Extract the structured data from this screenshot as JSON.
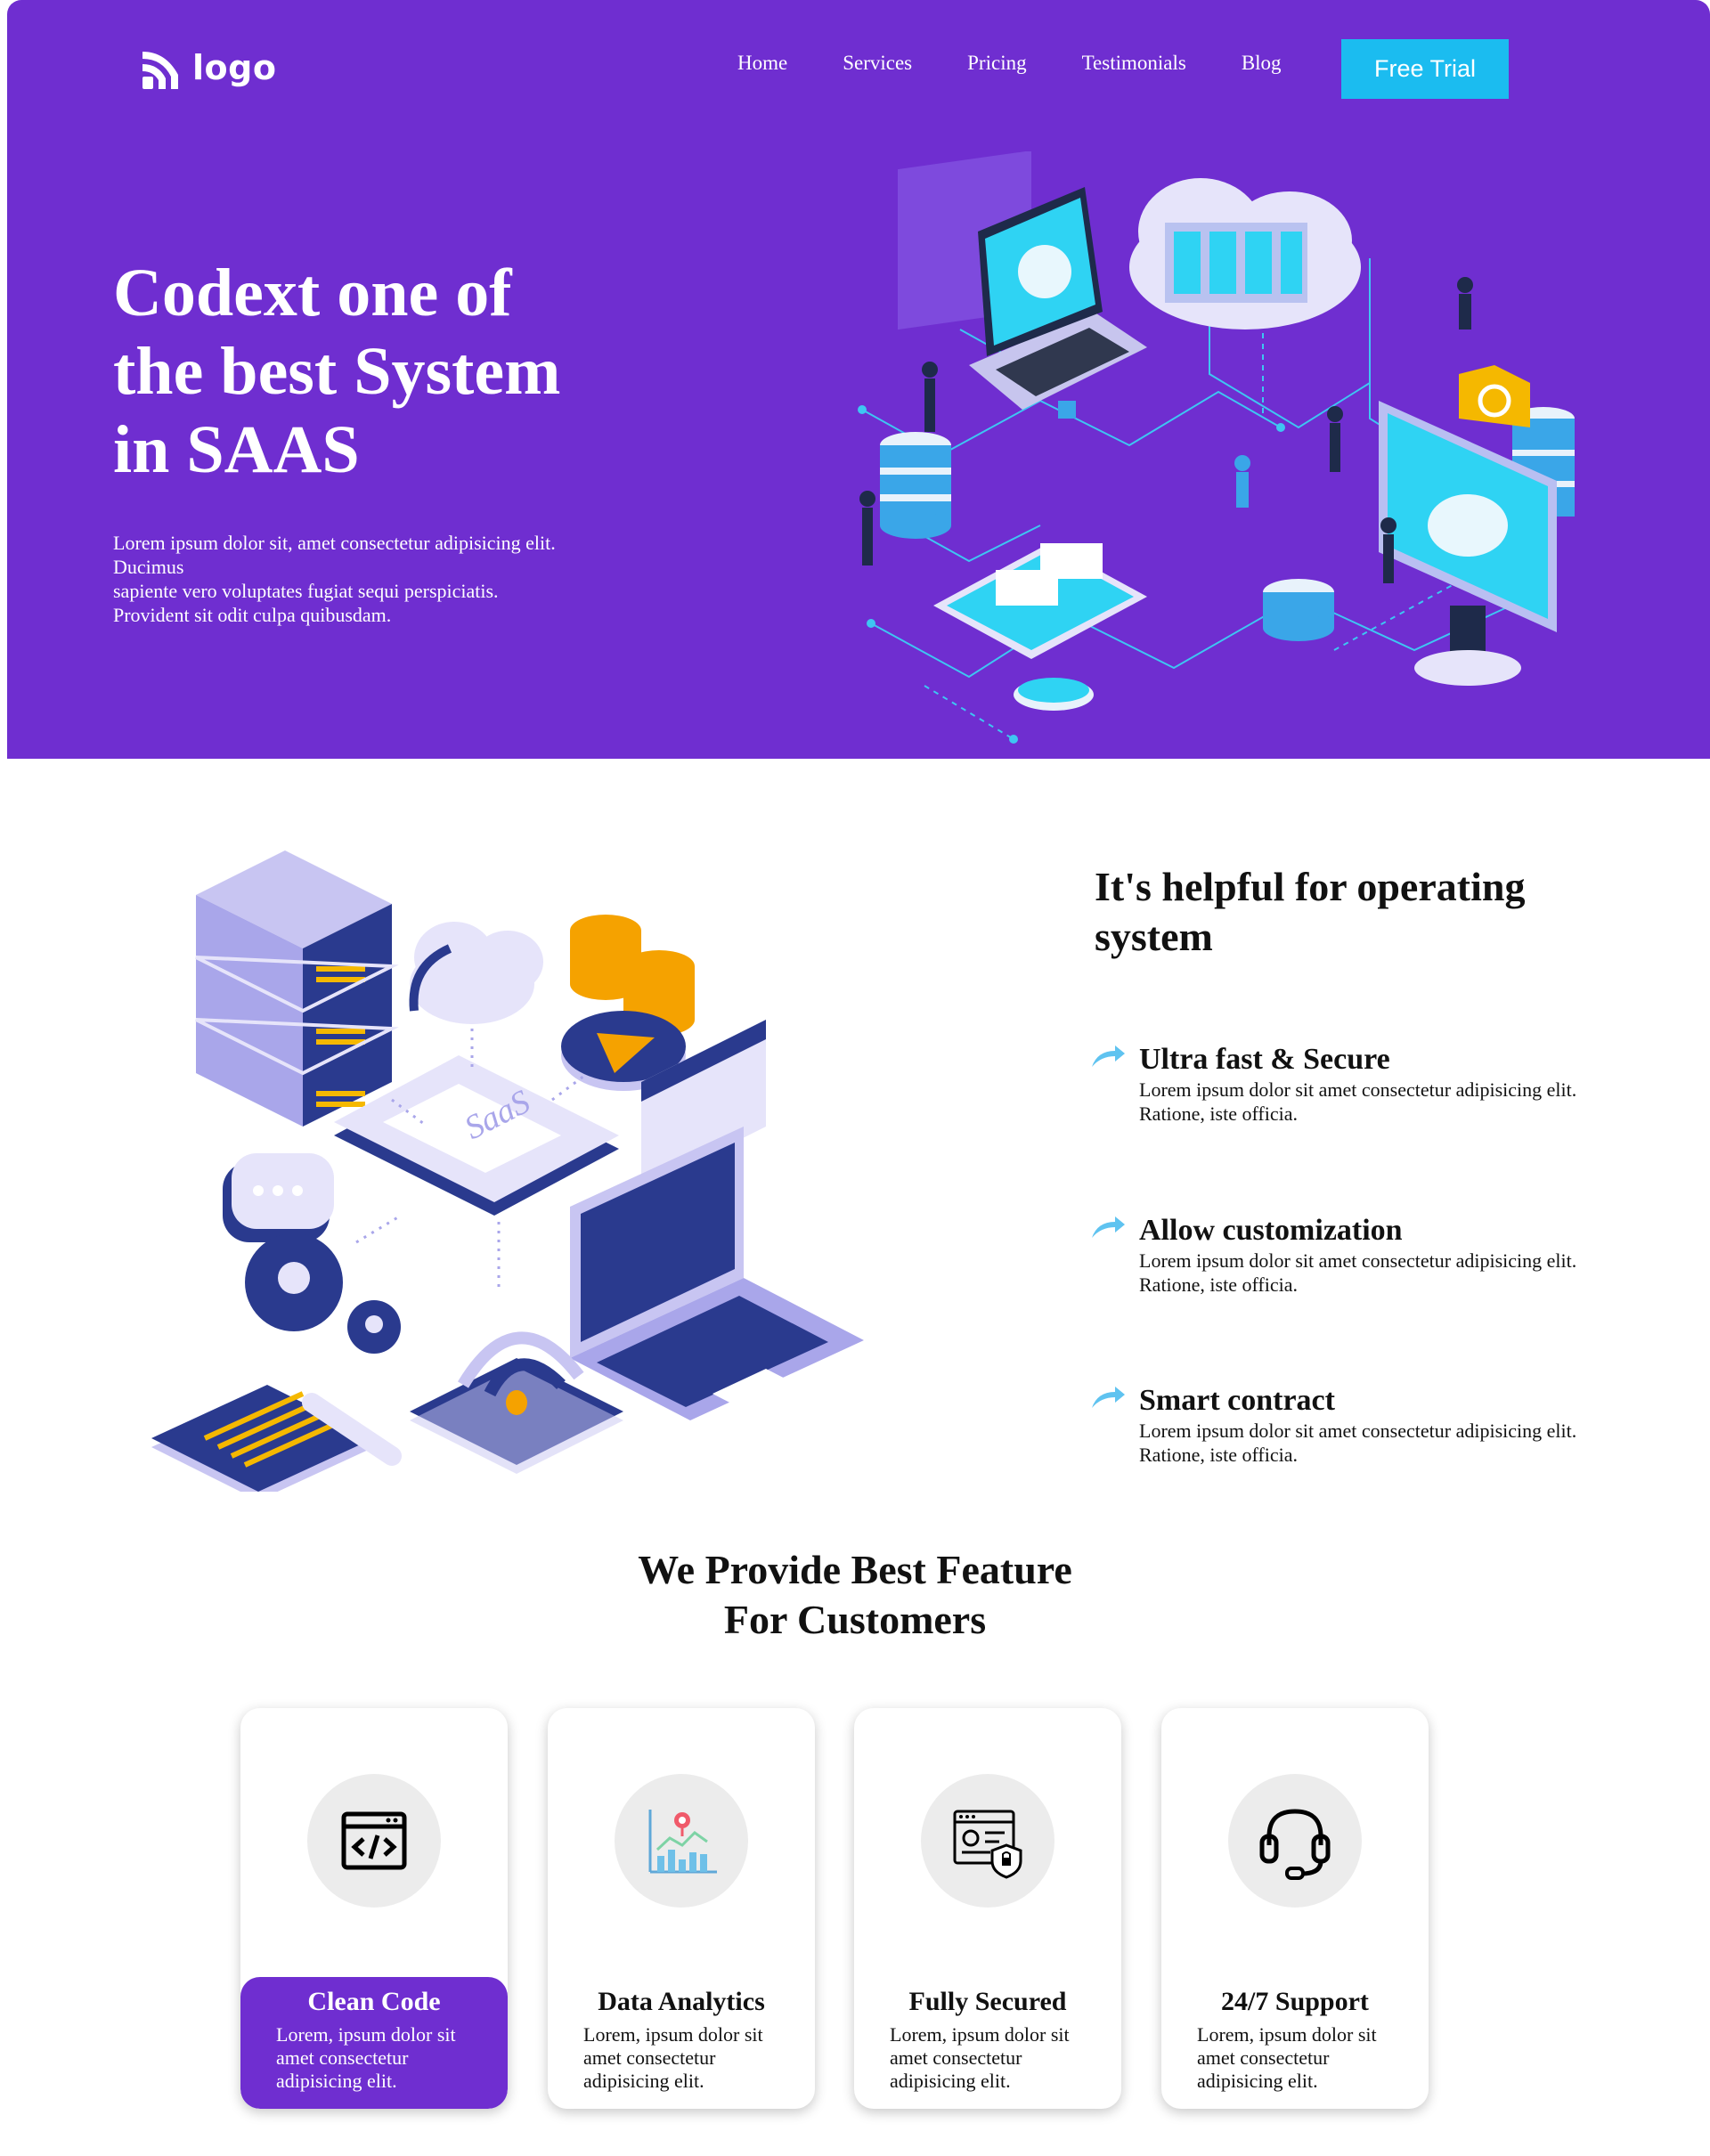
{
  "header": {
    "logo_text": "logo",
    "nav": [
      "Home",
      "Services",
      "Pricing",
      "Testimonials",
      "Blog"
    ],
    "cta_label": "Free Trial"
  },
  "hero": {
    "title_lines": [
      "Codext one of",
      "the best System",
      "in SAAS"
    ],
    "desc_lines": [
      "Lorem ipsum dolor sit, amet consectetur adipisicing elit.",
      "Ducimus",
      "sapiente vero voluptates fugiat sequi perspiciatis.",
      "Provident sit odit culpa quibusdam."
    ]
  },
  "helpful": {
    "title": "It's helpful for operating system",
    "items": [
      {
        "title": "Ultra fast & Secure",
        "text": "Lorem ipsum dolor sit amet consectetur adipisicing elit. Ratione, iste officia."
      },
      {
        "title": "Allow customization",
        "text": "Lorem ipsum dolor sit amet consectetur adipisicing elit. Ratione, iste officia."
      },
      {
        "title": "Smart contract",
        "text": "Lorem ipsum dolor sit amet consectetur adipisicing elit. Ratione, iste officia."
      }
    ],
    "illustration_label": "SaaS"
  },
  "features": {
    "title_lines": [
      "We Provide Best Feature",
      "For Customers"
    ],
    "cards": [
      {
        "title": "Clean Code",
        "text": "Lorem, ipsum dolor sit amet consectetur adipisicing elit.",
        "icon": "code-window-icon"
      },
      {
        "title": "Data Analytics",
        "text": "Lorem, ipsum dolor sit amet consectetur adipisicing elit.",
        "icon": "analytics-chart-icon"
      },
      {
        "title": "Fully Secured",
        "text": "Lorem, ipsum dolor sit amet consectetur adipisicing elit.",
        "icon": "secure-profile-icon"
      },
      {
        "title": "24/7 Support",
        "text": "Lorem, ipsum dolor sit amet consectetur adipisicing elit.",
        "icon": "headset-icon"
      }
    ]
  },
  "colors": {
    "primary": "#6f2ed0",
    "accent": "#1bbcf0",
    "arrow": "#5fc3f0"
  }
}
